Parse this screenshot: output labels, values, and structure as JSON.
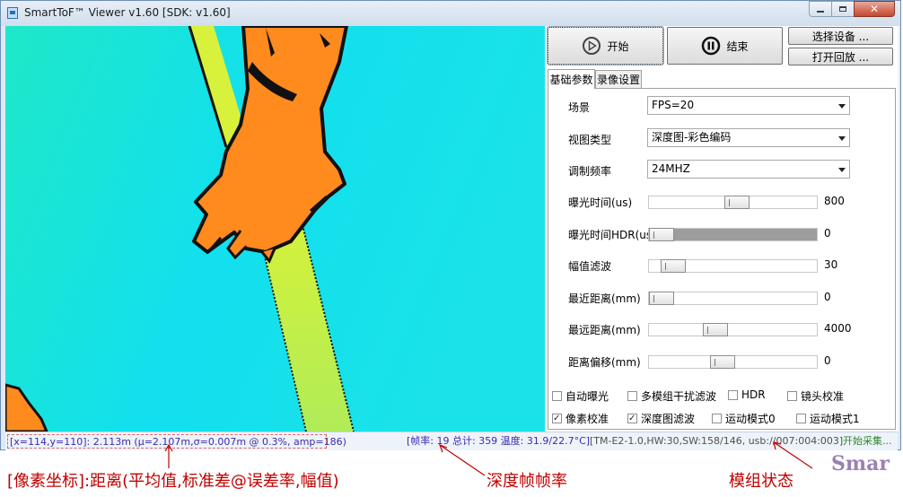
{
  "window": {
    "title": "SmartToF™ Viewer v1.60 [SDK: v1.60]"
  },
  "toolbar": {
    "start_label": "开始",
    "stop_label": "结束",
    "select_device_label": "选择设备 ...",
    "open_playback_label": "打开回放 ..."
  },
  "tabs": [
    {
      "label": "基础参数",
      "active": true
    },
    {
      "label": "录像设置",
      "active": false
    }
  ],
  "params": {
    "scene": {
      "label": "场景",
      "value": "FPS=20"
    },
    "view_type": {
      "label": "视图类型",
      "value": "深度图-彩色编码"
    },
    "modulation": {
      "label": "调制频率",
      "value": "24MHZ"
    },
    "sliders": [
      {
        "label": "曝光时间(us)",
        "value": "800",
        "position": 0.53,
        "fill": 0
      },
      {
        "label": "曝光时间HDR(us)",
        "value": "0",
        "position": 0.0,
        "fill": 1
      },
      {
        "label": "幅值滤波",
        "value": "30",
        "position": 0.08,
        "fill": 0
      },
      {
        "label": "最近距离(mm)",
        "value": "0",
        "position": 0.0,
        "fill": 0
      },
      {
        "label": "最远距离(mm)",
        "value": "4000",
        "position": 0.38,
        "fill": 0
      },
      {
        "label": "距离偏移(mm)",
        "value": "0",
        "position": 0.43,
        "fill": 0
      }
    ]
  },
  "checkboxes": [
    {
      "label": "自动曝光",
      "checked": false
    },
    {
      "label": "多模组干扰滤波",
      "checked": false
    },
    {
      "label": "HDR",
      "checked": false
    },
    {
      "label": "镜头校准",
      "checked": false
    },
    {
      "label": "像素校准",
      "checked": true
    },
    {
      "label": "深度图滤波",
      "checked": true
    },
    {
      "label": "运动模式0",
      "checked": false
    },
    {
      "label": "运动模式1",
      "checked": false
    }
  ],
  "status": {
    "pixel_info": "[x=114,y=110]: 2.113m (μ=2.107m,σ=0.007m @ 0.3%, amp=186)",
    "fps_info": "[帧率: 19 总计: 359 温度: 31.9/22.7°C]",
    "module_info": "[TM-E2-1.0,HW:30,SW:158/146, usb://007:004:003]",
    "capture_state": "开始采集..."
  },
  "annotations": {
    "pixel": "[像素坐标]:距离(平均值,标准差@误差率,幅值)",
    "fps": "深度帧帧率",
    "module": "模组状态",
    "watermark": "Smar"
  },
  "colors": {
    "depth_near": "#ff7f1a",
    "depth_mid": "#c8f040",
    "depth_far": "#17e6e6",
    "annotation": "#c00000"
  }
}
